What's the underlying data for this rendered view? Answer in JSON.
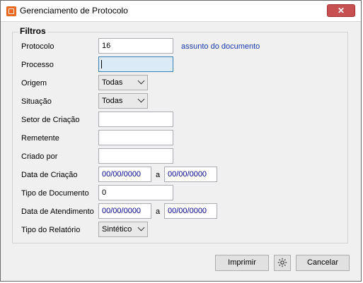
{
  "window": {
    "title": "Gerenciamento de Protocolo",
    "close_label": "✕"
  },
  "filters": {
    "group_label": "Filtros",
    "protocolo_label": "Protocolo",
    "protocolo_value": "16",
    "assunto_link": "assunto do documento",
    "processo_label": "Processo",
    "processo_value": "",
    "origem_label": "Origem",
    "origem_value": "Todas",
    "situacao_label": "Situação",
    "situacao_value": "Todas",
    "setor_label": "Setor de Criação",
    "setor_value": "",
    "remetente_label": "Remetente",
    "remetente_value": "",
    "criado_por_label": "Criado por",
    "criado_por_value": "",
    "data_criacao_label": "Data de Criação",
    "data_criacao_de": "00/00/0000",
    "data_criacao_ate": "00/00/0000",
    "tipo_documento_label": "Tipo de Documento",
    "tipo_documento_value": "0",
    "data_atendimento_label": "Data de Atendimento",
    "data_atendimento_de": "00/00/0000",
    "data_atendimento_ate": "00/00/0000",
    "tipo_relatorio_label": "Tipo do Relatório",
    "tipo_relatorio_value": "Sintético",
    "range_sep": "a"
  },
  "buttons": {
    "imprimir": "Imprimir",
    "cancelar": "Cancelar"
  },
  "icons": {
    "app": "protocol-app-icon",
    "settings": "gear-icon"
  }
}
